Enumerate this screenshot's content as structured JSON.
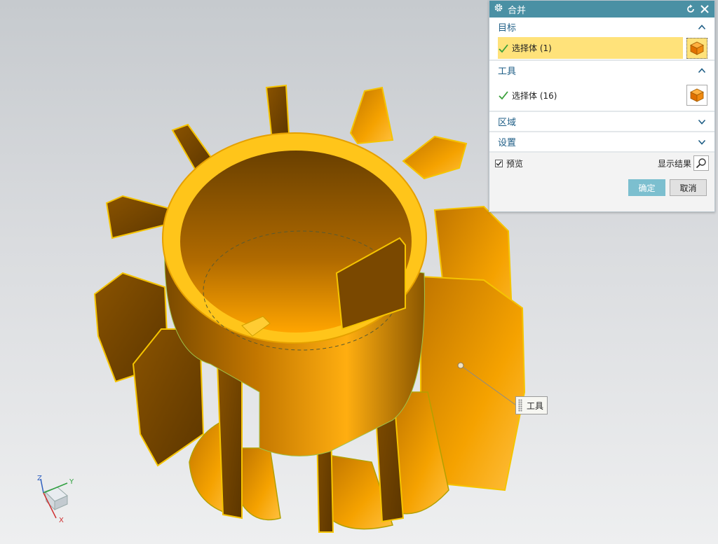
{
  "dialog": {
    "title": "合并",
    "target": {
      "heading": "目标",
      "select_label": "选择体 (1)"
    },
    "tool": {
      "heading": "工具",
      "select_label": "选择体 (16)"
    },
    "region": {
      "heading": "区域"
    },
    "settings": {
      "heading": "设置"
    },
    "preview_label": "预览",
    "preview_checked": true,
    "show_result_label": "显示结果",
    "ok_label": "确定",
    "cancel_label": "取消"
  },
  "viewport": {
    "tool_tag_label": "工具",
    "triad_labels": {
      "x": "X",
      "y": "Y",
      "z": "Z"
    }
  },
  "colors": {
    "titlebar": "#4a90a4",
    "section_heading": "#1f5e86",
    "highlight": "#ffe27a",
    "ok_button": "#7cbfcf",
    "model_orange": "#f0a000"
  },
  "icons": [
    "gear-icon",
    "reset-icon",
    "close-icon",
    "chevron-up-icon",
    "chevron-down-icon",
    "checkmark-icon",
    "solid-body-icon",
    "magnifier-icon"
  ]
}
